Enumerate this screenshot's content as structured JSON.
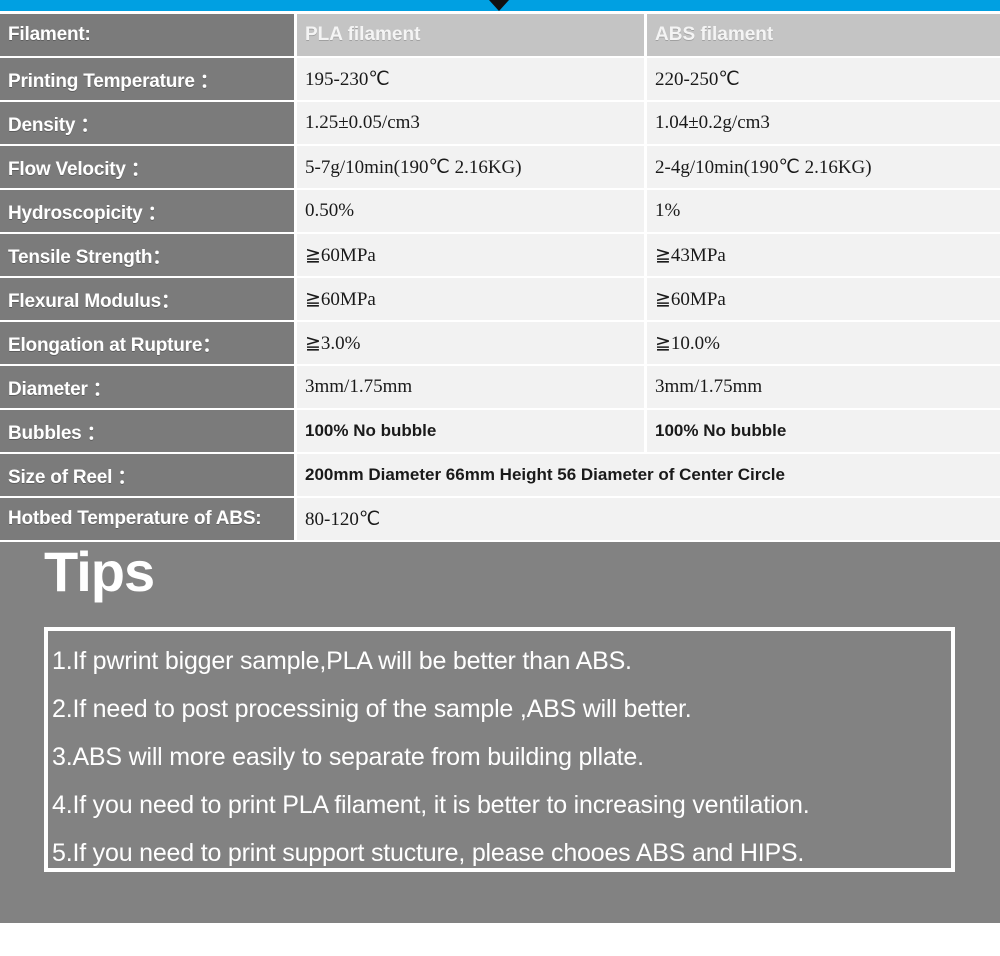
{
  "banner": {
    "color": "#00a0e2",
    "arrow_color": "#111111"
  },
  "table": {
    "columns": [
      "Filament:",
      "PLA filament",
      "ABS filament"
    ],
    "rows": [
      {
        "label": "Printing Temperature ：",
        "pla": "195-230℃",
        "abs": "220-250℃"
      },
      {
        "label": "Density ：",
        "pla": "1.25±0.05/cm3",
        "abs": "1.04±0.2g/cm3"
      },
      {
        "label": "Flow Velocity ：",
        "pla": "5-7g/10min(190℃ 2.16KG)",
        "abs": "2-4g/10min(190℃ 2.16KG)"
      },
      {
        "label": "Hydroscopicity ：",
        "pla": "0.50%",
        "abs": "1%"
      },
      {
        "label": "Tensile Strength：",
        "pla": "≧60MPa",
        "abs": "≧43MPa"
      },
      {
        "label": "Flexural Modulus：",
        "pla": "≧60MPa",
        "abs": "≧60MPa"
      },
      {
        "label": "Elongation at Rupture：",
        "pla": "≧3.0%",
        "abs": "≧10.0%"
      },
      {
        "label": "Diameter ：",
        "pla": "3mm/1.75mm",
        "abs": "3mm/1.75mm"
      },
      {
        "label": "Bubbles ：",
        "pla": "100% No bubble",
        "abs": "100% No bubble"
      },
      {
        "label": "Size of Reel ：",
        "pla": "200mm Diameter  66mm Height   56 Diameter of Center Circle",
        "abs": ""
      },
      {
        "label": "Hotbed Temperature of ABS:",
        "pla": "80-120℃",
        "abs": ""
      }
    ]
  },
  "tips": {
    "title": "Tips",
    "lines": [
      "1.If pwrint bigger sample,PLA will be better than ABS.",
      "2.If need to post processinig of the sample ,ABS will better.",
      "3.ABS will more easily to separate from building pllate.",
      "4.If you need to print PLA filament, it is better to increasing ventilation.",
      "5.If you need to print support stucture, please chooes ABS and HIPS."
    ]
  }
}
